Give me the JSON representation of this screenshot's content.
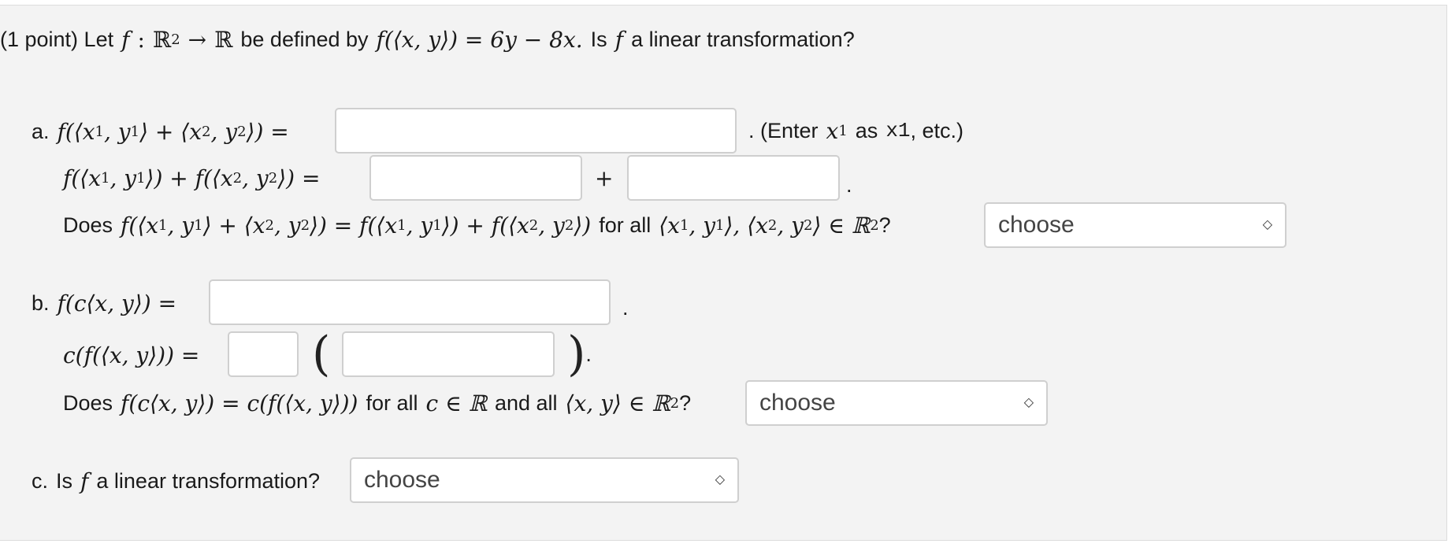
{
  "question": {
    "intro_prefix": "(1 point) Let",
    "f": "f",
    "colon": ":",
    "domain": "ℝ",
    "domain_exp": "2",
    "arrow": "→",
    "codomain": "ℝ",
    "be_defined": "be defined by",
    "definition": "f(⟨x, y⟩) = 6y − 8x.",
    "is_text": "Is",
    "linear_text": "a linear transformation?"
  },
  "part_a": {
    "label": "a.",
    "lhs1": "f(⟨x",
    "lhs2": ", y",
    "lhs3": "⟩ + ⟨x",
    "lhs4": ", y",
    "lhs5": "⟩) =",
    "sub1": "1",
    "sub2": "2",
    "hint_prefix": ". (Enter",
    "hint_x": "x",
    "hint_sub": "1",
    "hint_as": "as",
    "hint_code": "x1",
    "hint_suffix": ", etc.)",
    "sum1": "f(⟨x",
    "sum2": ", y",
    "sum3": "⟩) + f(⟨x",
    "sum4": ", y",
    "sum5": "⟩) =",
    "plus": "+",
    "period": ".",
    "does": "Does",
    "q1": "f(⟨x",
    "q2": ", y",
    "q3": "⟩ + ⟨x",
    "q4": ", y",
    "q5": "⟩) = f(⟨x",
    "q6": ", y",
    "q7": "⟩) + f(⟨x",
    "q8": ", y",
    "q9": "⟩)",
    "for_all": "for all",
    "set1": "⟨x",
    "set2": ", y",
    "set3": "⟩, ⟨x",
    "set4": ", y",
    "set5": "⟩ ∈ ℝ",
    "exp": "2",
    "qmark": "?",
    "select_value": "choose",
    "input1_value": "",
    "input2_value": "",
    "input3_value": ""
  },
  "part_b": {
    "label": "b.",
    "lhs": "f(c⟨x, y⟩) =",
    "period": ".",
    "lhs2": "c(f(⟨x, y⟩)) =",
    "open_paren": "(",
    "close_paren": ")",
    "does": "Does",
    "q": "f(c⟨x, y⟩) = c(f(⟨x, y⟩))",
    "for_all": "for all",
    "c_in": "c ∈ ℝ",
    "and_all": "and all",
    "xy_in": "⟨x, y⟩ ∈ ℝ",
    "exp": "2",
    "qmark": "?",
    "select_value": "choose",
    "input1_value": "",
    "input2_value": "",
    "input3_value": ""
  },
  "part_c": {
    "label": "c.",
    "is_text": "Is",
    "f": "f",
    "rest": "a linear transformation?",
    "select_value": "choose"
  }
}
